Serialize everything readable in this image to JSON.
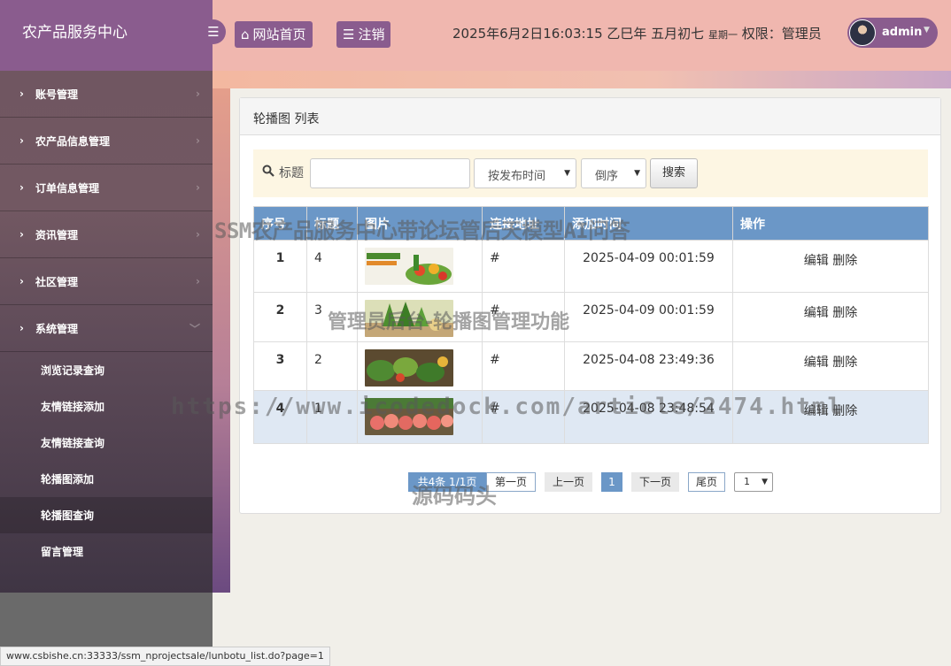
{
  "brand": {
    "title": "农产品服务中心"
  },
  "header": {
    "collapse_icon": "menu-icon",
    "home_label": "网站首页",
    "logout_label": "注销",
    "datetime": "2025年6月2日16:03:15 乙巳年 五月初七",
    "weekday": "星期一",
    "role": "权限：管理员",
    "username": "admin"
  },
  "sidebar": {
    "items": [
      {
        "label": "账号管理"
      },
      {
        "label": "农产品信息管理"
      },
      {
        "label": "订单信息管理"
      },
      {
        "label": "资讯管理"
      },
      {
        "label": "社区管理"
      },
      {
        "label": "系统管理"
      }
    ],
    "subitems": [
      {
        "label": "浏览记录查询"
      },
      {
        "label": "友情链接添加"
      },
      {
        "label": "友情链接查询"
      },
      {
        "label": "轮播图添加"
      },
      {
        "label": "轮播图查询"
      },
      {
        "label": "留言管理"
      }
    ]
  },
  "panel": {
    "title": "轮播图 列表"
  },
  "search": {
    "label": "标题",
    "value": "",
    "sort_field": "按发布时间",
    "sort_order": "倒序",
    "button": "搜索"
  },
  "table": {
    "columns": [
      "序号",
      "标题",
      "图片",
      "连接地址",
      "添加时间",
      "操作"
    ],
    "rows": [
      {
        "no": "1",
        "title": "4",
        "link": "#",
        "time": "2025-04-09 00:01:59",
        "edit": "编辑",
        "del": "删除"
      },
      {
        "no": "2",
        "title": "3",
        "link": "#",
        "time": "2025-04-09 00:01:59",
        "edit": "编辑",
        "del": "删除"
      },
      {
        "no": "3",
        "title": "2",
        "link": "#",
        "time": "2025-04-08 23:49:36",
        "edit": "编辑",
        "del": "删除"
      },
      {
        "no": "4",
        "title": "1",
        "link": "#",
        "time": "2025-04-08 23:48:54",
        "edit": "编辑",
        "del": "删除"
      }
    ]
  },
  "pager": {
    "info": "共4条 1/1页",
    "first": "第一页",
    "prev": "上一页",
    "current": "1",
    "next": "下一页",
    "last": "尾页",
    "select": "1"
  },
  "watermarks": {
    "line1": "SSM农产品服务中心带论坛管后天模型AI问答",
    "line2": "管理员后台-轮播图管理功能",
    "line3": "https://www.icodedock.com/article/2474.html",
    "line4": "源码码头"
  },
  "statusbar": {
    "url": "www.csbishe.cn:33333/ssm_nprojectsale/lunbotu_list.do?page=1"
  },
  "colors": {
    "brand": "#8a5c8e",
    "header": "#f0b7af",
    "table_header": "#6b97c7"
  }
}
